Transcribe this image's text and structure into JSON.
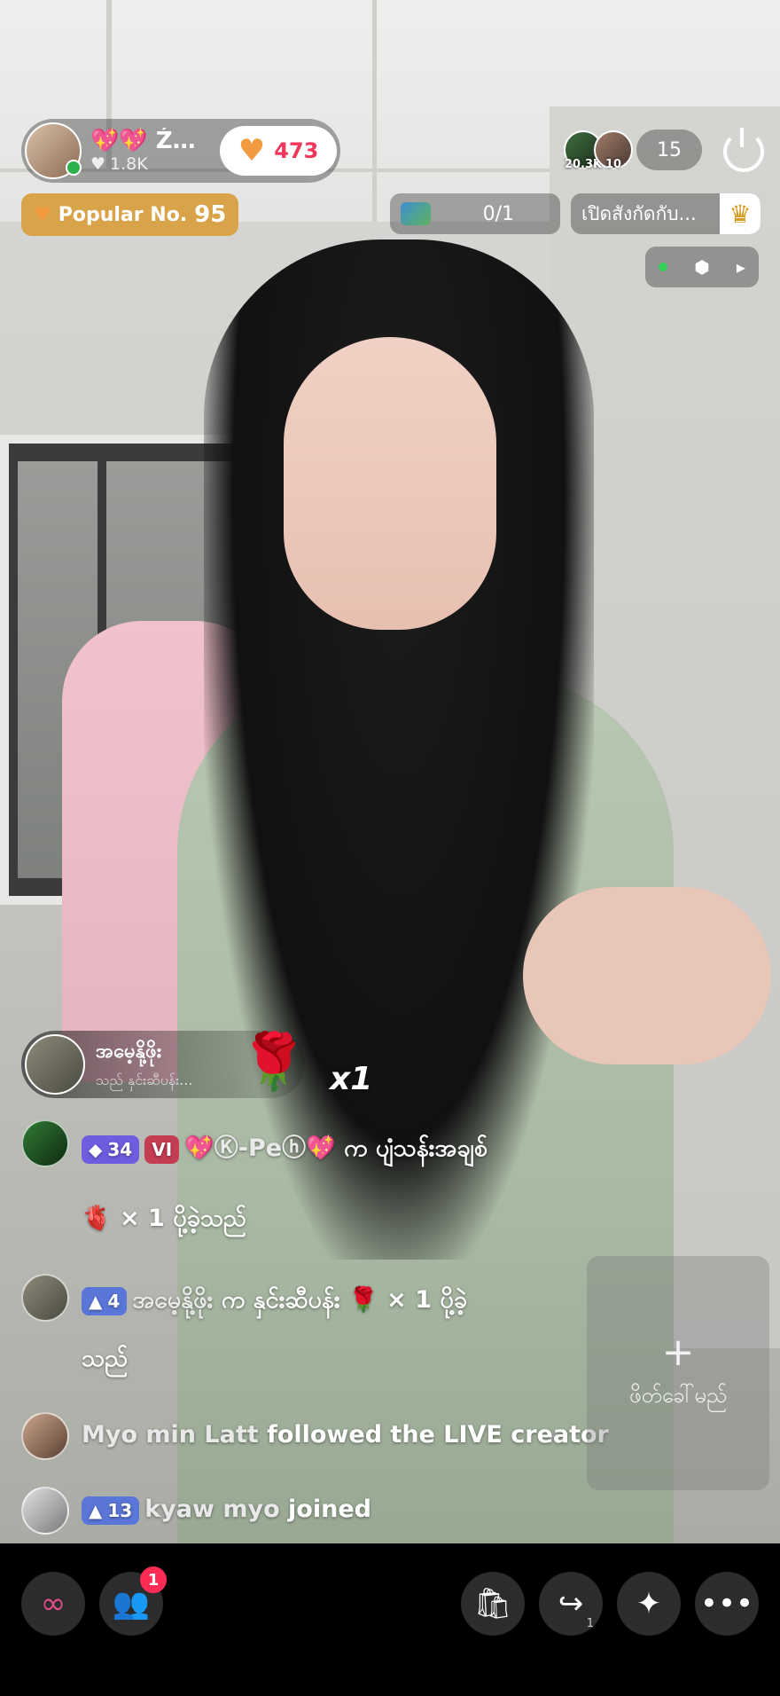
{
  "host": {
    "name": "💖💖 Ź…",
    "likes": "1.8K",
    "like_count": "473"
  },
  "popular": {
    "label": "Popular No.",
    "rank": "95"
  },
  "viewers": {
    "top1_score": "20.3K",
    "top2_score": "10",
    "count": "15"
  },
  "goal": {
    "value": "0/1"
  },
  "subscribe": {
    "label": "เปิดสังกัดกับ..."
  },
  "gift": {
    "sender": "အမေ့နို့ဖိုး",
    "subtitle": "သည် နှင်းဆီပန်း...",
    "multiplier": "x1"
  },
  "chat": [
    {
      "level": "34",
      "vip": "VI",
      "name": "💖Ⓚ-Peⓗ💖",
      "text": "က ပျံသန်းအချစ်",
      "cont": "🫀 × 1 ပို့ခဲ့သည်"
    },
    {
      "level": "4",
      "name": "အမေ့နို့ဖိုး",
      "text": "က နှင်းဆီပန်း 🌹 × 1 ပို့ခဲ့",
      "cont": "သည်"
    },
    {
      "name": "Myo min Latt",
      "text": "followed the LIVE creator"
    },
    {
      "level": "13",
      "name": "kyaw myo",
      "text": "joined"
    }
  ],
  "add_button": {
    "label": "ဖိတ်ခေါ်မည်"
  },
  "bottom": {
    "friends_badge": "1",
    "share_count": "1"
  },
  "colors": {
    "accent": "#fe2c55",
    "popular": "#d9a449",
    "like": "#f0365a"
  }
}
